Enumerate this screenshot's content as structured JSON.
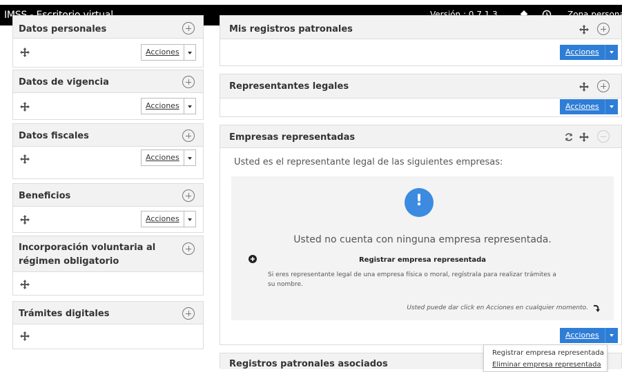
{
  "topbar": {
    "brand": "IMSS - Escritorio virtual",
    "version": "Versión : 0.7.1.3",
    "zona": "Zona persona"
  },
  "left_panels": [
    {
      "title": "Datos personales",
      "actions": "Acciones"
    },
    {
      "title": "Datos de vigencia",
      "actions": "Acciones"
    },
    {
      "title": "Datos fiscales",
      "actions": "Acciones"
    },
    {
      "title": "Beneficios",
      "actions": "Acciones"
    },
    {
      "title_line1": "Incorporación voluntaria al",
      "title_line2": "régimen obligatorio"
    },
    {
      "title": "Trámites digitales"
    }
  ],
  "right_panels": {
    "registros": {
      "title": "Mis registros patronales",
      "actions": "Acciones"
    },
    "representantes": {
      "title": "Representantes legales",
      "actions": "Acciones"
    },
    "empresas": {
      "title": "Empresas representadas",
      "intro": "Usted es el representante legal de las siguientes empresas:",
      "empty_msg": "Usted no cuenta con ninguna empresa representada.",
      "register_title": "Registrar empresa representada",
      "register_desc_1": "Si eres representante legal de una empresa física o moral, regístrala para realizar trámites a",
      "register_desc_2": "su nombre.",
      "hint": "Usted puede dar click en Acciones en cualquier momento.",
      "actions": "Acciones"
    },
    "asociados": {
      "title": "Registros patronales asociados"
    }
  },
  "dropdown": {
    "items": [
      "Registrar empresa representada",
      "Eliminar empresa representada"
    ]
  },
  "colors": {
    "accent": "#2e7dd6",
    "topbar": "#000000",
    "panel_header": "#f2f2f2"
  }
}
